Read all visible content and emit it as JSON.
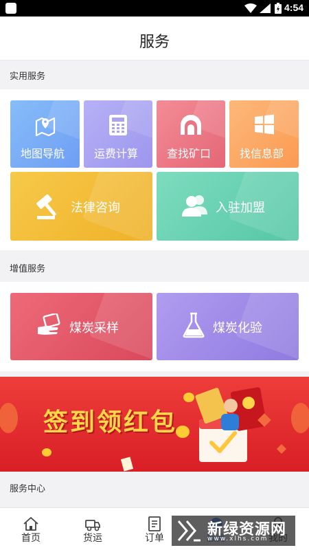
{
  "status_bar": {
    "time": "4:54"
  },
  "header": {
    "title": "服务"
  },
  "sections": {
    "practical": "实用服务",
    "value_added": "增值服务",
    "service_center": "服务中心"
  },
  "practical_services": [
    {
      "label": "地图导航",
      "icon": "map-pin-icon",
      "color": "#7aadf6"
    },
    {
      "label": "运费计算",
      "icon": "calculator-icon",
      "color": "#a9a3f2"
    },
    {
      "label": "查找矿口",
      "icon": "mine-tunnel-icon",
      "color": "#ec7482"
    },
    {
      "label": "找信息部",
      "icon": "windows-grid-icon",
      "color": "#fca866"
    },
    {
      "label": "法律咨询",
      "icon": "gavel-icon",
      "color": "#f2bd37"
    },
    {
      "label": "入驻加盟",
      "icon": "users-icon",
      "color": "#68d2b2"
    }
  ],
  "value_added_services": [
    {
      "label": "煤炭采样",
      "icon": "hand-sample-icon",
      "color": "#e35a6a"
    },
    {
      "label": "煤炭化验",
      "icon": "flask-icon",
      "color": "#a08cea"
    }
  ],
  "banner": {
    "text": "签到领红包",
    "background": "#e32a2e",
    "text_color": "#ffd64a"
  },
  "bottom_nav": [
    {
      "label": "首页",
      "icon": "home-icon",
      "active": false
    },
    {
      "label": "货运",
      "icon": "truck-icon",
      "active": false
    },
    {
      "label": "订单",
      "icon": "order-list-icon",
      "active": false
    },
    {
      "label": "服务",
      "icon": "service-globe-icon",
      "active": true
    },
    {
      "label": "我的",
      "icon": "profile-icon",
      "active": false
    }
  ],
  "watermark": {
    "main": "新绿资源网",
    "sub": "www.xlhs.com"
  }
}
